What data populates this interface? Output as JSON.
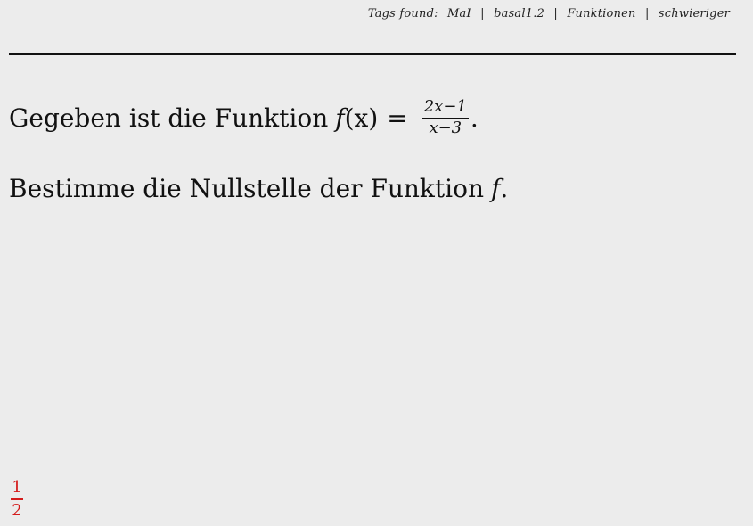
{
  "header": {
    "tags_label": "Tags found:",
    "tags": [
      "MaI",
      "basal1.2",
      "Funktionen",
      "schwieriger"
    ],
    "separator": "|"
  },
  "content": {
    "line1": {
      "prefix": "Gegeben ist die Funktion",
      "func_name": "f",
      "func_arg": "(x)",
      "equals": "=",
      "numerator": "2x−1",
      "denominator": "x−3",
      "suffix": "."
    },
    "line2": {
      "prefix": "Bestimme die Nullstelle der Funktion",
      "func_name": "f",
      "suffix": "."
    }
  },
  "page": {
    "current": "1",
    "total": "2",
    "color": "#d41c1c"
  }
}
